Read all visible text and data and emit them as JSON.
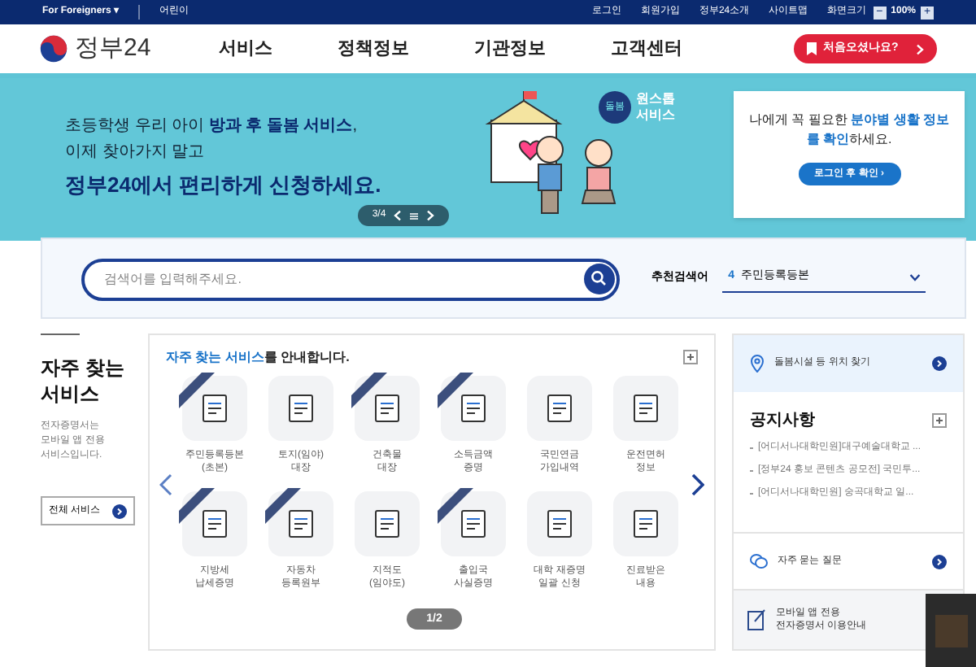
{
  "top_bar": {
    "left_links": [
      "For Foreigners ▾",
      "어린이"
    ],
    "right_links": [
      "로그인",
      "회원가입",
      "정부24소개",
      "사이트맵"
    ],
    "zoom_label": "화면크기",
    "zoom_minus": "−",
    "zoom_value": "100%",
    "zoom_plus": "+"
  },
  "header": {
    "logo": "정부24",
    "nav": [
      "서비스",
      "정책정보",
      "기관정보",
      "고객센터"
    ],
    "first_visit_button": "처음오셨나요?"
  },
  "banner": {
    "lines": [
      "초등학생 우리 아이 **방과 후 돌봄 서비스**,",
      "이제 찾아가지 말고",
      "정부24에서 편리하게 신청하세요."
    ],
    "badge": "원스톱\n서비스",
    "badge_emblem": "돌봄",
    "pager": "3/4",
    "login_card": {
      "text": "나에게 꼭 필요한 **분야별 생활 정보를 확인**하세요.",
      "button": "로그인 후 확인 ›"
    }
  },
  "search": {
    "placeholder": "검색어를 입력해주세요.",
    "recommended_label": "추천검색어",
    "recommended_rank": "4",
    "recommended_term": "주민등록등본"
  },
  "frequent": {
    "title": "자주 찾는\n서비스",
    "description": "전자증명서는\n모바일 앱 전용\n서비스입니다.",
    "all_button": "전체 서비스",
    "heading": "**자주 찾는 서비스**를 안내합니다.",
    "page": "1/2",
    "items": [
      {
        "label": "주민등록등본\n(초본)",
        "ribbon": true
      },
      {
        "label": "토지(임야)\n대장",
        "ribbon": false
      },
      {
        "label": "건축물\n대장",
        "ribbon": true
      },
      {
        "label": "소득금액\n증명",
        "ribbon": true
      },
      {
        "label": "국민연금\n가입내역",
        "ribbon": false
      },
      {
        "label": "운전면허\n정보",
        "ribbon": false
      },
      {
        "label": "지방세\n납세증명",
        "ribbon": true
      },
      {
        "label": "자동차\n등록원부",
        "ribbon": true
      },
      {
        "label": "지적도\n(임야도)",
        "ribbon": false
      },
      {
        "label": "출입국\n사실증명",
        "ribbon": true
      },
      {
        "label": "대학 재증명\n일괄 신청",
        "ribbon": false
      },
      {
        "label": "진료받은\n내용",
        "ribbon": false
      }
    ]
  },
  "side": {
    "location_link": "돌봄시설 등 위치 찾기",
    "notice_title": "공지사항",
    "notices": [
      "[어디서나대학민원]대구예술대학교 ...",
      "[정부24 홍보 콘텐츠 공모전] 국민투...",
      "[어디서나대학민원] 숭곡대학교 일..."
    ],
    "faq_link": "자주 묻는 질문",
    "mobile_note": [
      "모바일 앱 전용",
      "전자증명서 이용안내"
    ]
  }
}
